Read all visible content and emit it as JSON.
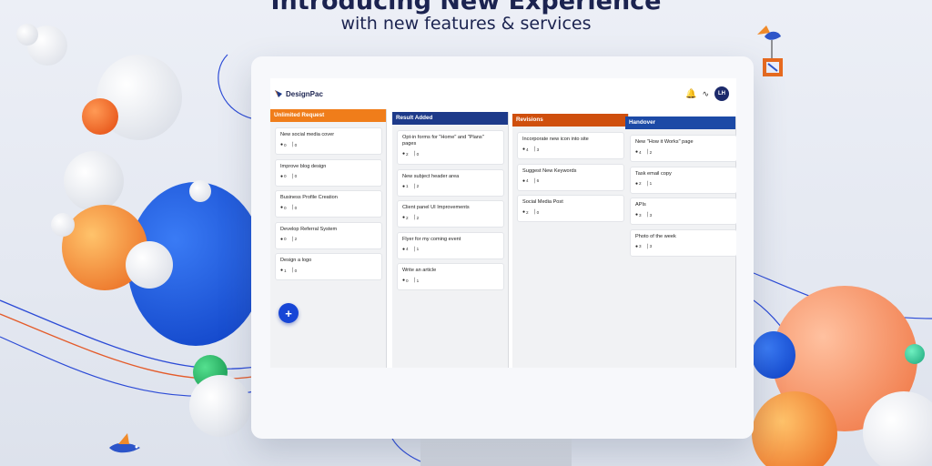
{
  "hero": {
    "headline": "Introducing New Experience",
    "subline": "with new features & services"
  },
  "app": {
    "brand": "DesignPac",
    "avatar_initials": "LH",
    "icons": {
      "notifications": "bell-icon",
      "activity": "activity-icon",
      "add": "plus-icon"
    },
    "add_label": "+"
  },
  "columns": [
    {
      "title": "Unlimited Request",
      "color": "#f07d1a",
      "cards": [
        {
          "title": "New social media cover",
          "comments": "0",
          "attachments": "0"
        },
        {
          "title": "Improve blog design",
          "comments": "0",
          "attachments": "0"
        },
        {
          "title": "Business Profile Creation",
          "comments": "0",
          "attachments": "0"
        },
        {
          "title": "Develop Referral System",
          "comments": "0",
          "attachments": "2"
        },
        {
          "title": "Design a logo",
          "comments": "1",
          "attachments": "0"
        }
      ]
    },
    {
      "title": "Result Added",
      "color": "#1d3a8a",
      "cards": [
        {
          "title": "Opt-in forms for \"Home\" and \"Plans\" pages",
          "comments": "2",
          "attachments": "0"
        },
        {
          "title": "New subject header area",
          "comments": "1",
          "attachments": "2"
        },
        {
          "title": "Client panel UI Improvements",
          "comments": "2",
          "attachments": "2"
        },
        {
          "title": "Flyer for my coming event",
          "comments": "4",
          "attachments": "1"
        },
        {
          "title": "Write an article",
          "comments": "0",
          "attachments": "1"
        }
      ]
    },
    {
      "title": "Revisions",
      "color": "#cf4f0d",
      "cards": [
        {
          "title": "Incorporate new icon into site",
          "comments": "4",
          "attachments": "3"
        },
        {
          "title": "Suggest New Keywords",
          "comments": "4",
          "attachments": "6"
        },
        {
          "title": "Social Media Post",
          "comments": "2",
          "attachments": "0"
        }
      ]
    },
    {
      "title": "Handover",
      "color": "#1c4aa6",
      "cards": [
        {
          "title": "New \"How it Works\" page",
          "comments": "4",
          "attachments": "2"
        },
        {
          "title": "Task email copy",
          "comments": "2",
          "attachments": "1"
        },
        {
          "title": "APIs",
          "comments": "3",
          "attachments": "3"
        },
        {
          "title": "Photo of the week",
          "comments": "3",
          "attachments": "3"
        }
      ]
    }
  ],
  "colors": {
    "orange": "#f07d1a",
    "navy": "#1d3a8a",
    "blue": "#1746d6",
    "dark_orange": "#cf4f0d"
  }
}
